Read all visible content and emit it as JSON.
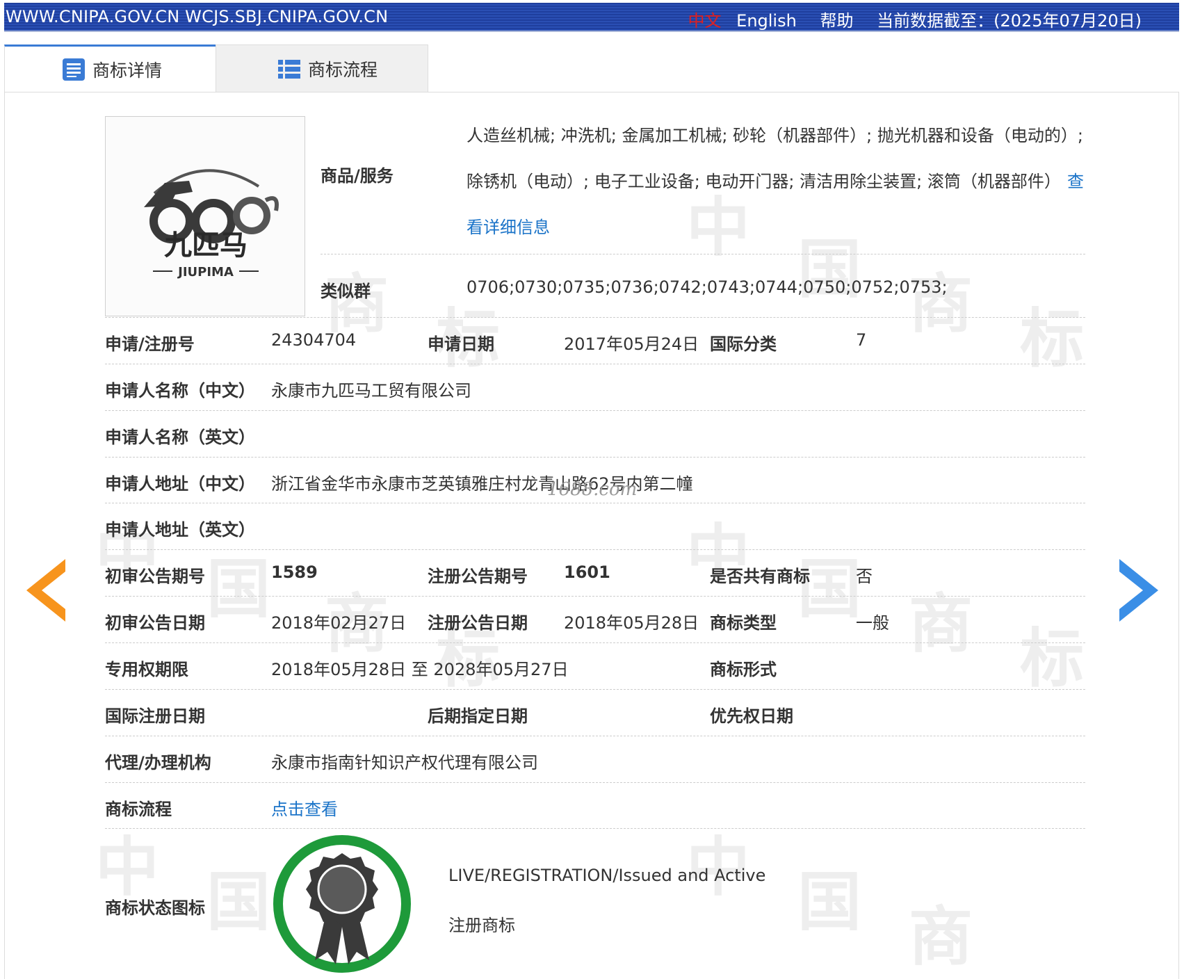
{
  "topbar": {
    "sites": "WWW.CNIPA.GOV.CN WCJS.SBJ.CNIPA.GOV.CN",
    "lang_cn": "中文",
    "lang_en": "English",
    "help": "帮助",
    "data_cutoff": "当前数据截至：(2025年07月20日)"
  },
  "tabs": {
    "detail": "商标详情",
    "flow": "商标流程"
  },
  "logo": {
    "brand_cn": "九匹马",
    "brand_en": "JIUPIMA"
  },
  "goods": {
    "label": "商品/服务",
    "line1": "人造丝机械; 冲洗机; 金属加工机械; 砂轮（机器部件）; 抛光机器和设备（电动的）;",
    "line2": "除锈机（电动）; 电子工业设备; 电动开门器; 清洁用除尘装置; 滚筒（机器部件）",
    "more_a": "查",
    "more_b": "看详细信息"
  },
  "similar": {
    "label": "类似群",
    "value": "0706;0730;0735;0736;0742;0743;0744;0750;0752;0753;"
  },
  "fields": {
    "reg_no_label": "申请/注册号",
    "reg_no": "24304704",
    "app_date_label": "申请日期",
    "app_date": "2017年05月24日",
    "intl_class_label": "国际分类",
    "intl_class": "7",
    "applicant_cn_label": "申请人名称（中文）",
    "applicant_cn": "永康市九匹马工贸有限公司",
    "applicant_en_label": "申请人名称（英文）",
    "applicant_en": "",
    "address_cn_label": "申请人地址（中文）",
    "address_cn": "浙江省金华市永康市芝英镇雅庄村龙青山路62号内第二幢",
    "address_watermark": "1688.com",
    "address_en_label": "申请人地址（英文）",
    "address_en": "",
    "prelim_no_label": "初审公告期号",
    "prelim_no": "1589",
    "reg_pub_no_label": "注册公告期号",
    "reg_pub_no": "1601",
    "shared_label": "是否共有商标",
    "shared": "否",
    "prelim_date_label": "初审公告日期",
    "prelim_date": "2018年02月27日",
    "reg_pub_date_label": "注册公告日期",
    "reg_pub_date": "2018年05月28日",
    "type_label": "商标类型",
    "type": "一般",
    "term_label": "专用权期限",
    "term": "2018年05月28日 至 2028年05月27日",
    "form_label": "商标形式",
    "form": "",
    "intl_reg_date_label": "国际注册日期",
    "intl_reg_date": "",
    "later_designation_label": "后期指定日期",
    "later_designation": "",
    "priority_label": "优先权日期",
    "priority": "",
    "agent_label": "代理/办理机构",
    "agent": "永康市指南针知识产权代理有限公司",
    "flow_label": "商标流程",
    "flow_link": "点击查看",
    "status_icon_label": "商标状态图标",
    "status_en": "LIVE/REGISTRATION/Issued and Active",
    "status_cn": "注册商标"
  },
  "watermark_text": [
    "中",
    "国",
    "商",
    "标"
  ],
  "colors": {
    "topbar_blue": "#1f3f9e",
    "link_blue": "#1a73c8",
    "prev_arrow": "#f7941d",
    "next_arrow": "#3a8ee6",
    "status_ring": "#1e9a3a"
  }
}
